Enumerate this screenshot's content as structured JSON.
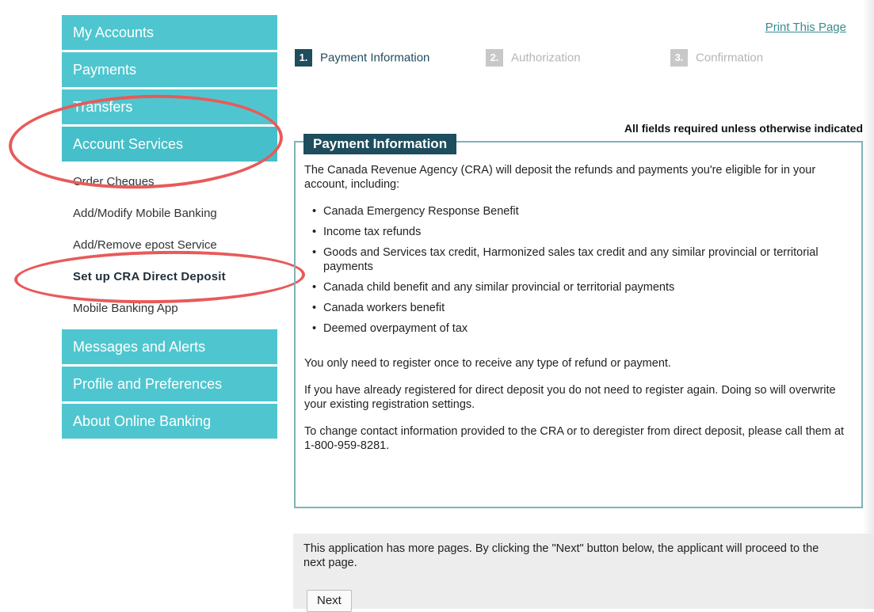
{
  "sidebar": {
    "top_items": [
      {
        "label": "My Accounts"
      },
      {
        "label": "Payments"
      },
      {
        "label": "Transfers"
      },
      {
        "label": "Account Services"
      }
    ],
    "sub_items": [
      {
        "label": "Order Cheques"
      },
      {
        "label": "Add/Modify Mobile Banking"
      },
      {
        "label": "Add/Remove epost Service"
      },
      {
        "label": "Set up CRA Direct Deposit"
      },
      {
        "label": "Mobile Banking App"
      }
    ],
    "bottom_items": [
      {
        "label": "Messages and Alerts"
      },
      {
        "label": "Profile and Preferences"
      },
      {
        "label": "About Online Banking"
      }
    ]
  },
  "header": {
    "print_label": "Print This Page",
    "steps": [
      {
        "num": "1.",
        "label": "Payment Information"
      },
      {
        "num": "2.",
        "label": "Authorization"
      },
      {
        "num": "3.",
        "label": "Confirmation"
      }
    ],
    "required_note": "All fields required unless otherwise indicated"
  },
  "info_box": {
    "legend": "Payment Information",
    "intro": "The Canada Revenue Agency (CRA) will deposit the refunds and payments you're eligible for in your account, including:",
    "bullets": [
      "Canada Emergency Response Benefit",
      "Income tax refunds",
      "Goods and Services tax credit, Harmonized sales tax credit and any similar provincial or territorial payments",
      "Canada child benefit and any similar provincial or territorial payments",
      "Canada workers benefit",
      "Deemed overpayment of tax"
    ],
    "para_register_once": "You only need to register once to receive any type of refund or payment.",
    "para_already_registered": "If you have already registered for direct deposit you do not need to register again. Doing so will overwrite your existing registration settings.",
    "para_change_contact": "To change contact information provided to the CRA or to deregister from direct deposit, please call them at 1-800-959-8281."
  },
  "footer": {
    "note": "This application has more pages. By clicking the \"Next\" button below, the applicant will proceed to the next page.",
    "next_label": "Next"
  },
  "colors": {
    "nav_teal": "#4fc6cf",
    "dark_teal": "#1e4d5e",
    "highlight_red": "#e85a5a"
  }
}
